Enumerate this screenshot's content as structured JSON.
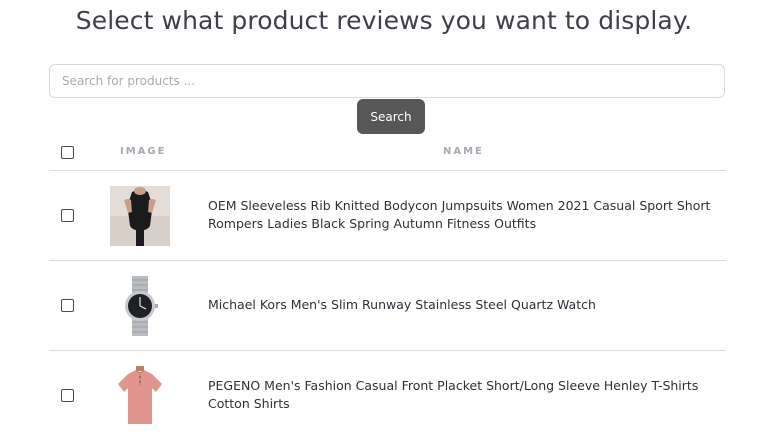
{
  "header": {
    "title": "Select what product reviews you want to display."
  },
  "search": {
    "placeholder": "Search for products ...",
    "value": "",
    "button_label": "Search"
  },
  "table": {
    "columns": [
      "IMAGE",
      "NAME"
    ],
    "rows": [
      {
        "image_icon": "bodysuit-product-photo",
        "name": "OEM Sleeveless Rib Knitted Bodycon Jumpsuits Women 2021 Casual Sport Short Rompers Ladies Black Spring Autumn Fitness Outfits",
        "checked": false
      },
      {
        "image_icon": "watch-product-photo",
        "name": "Michael Kors Men's Slim Runway Stainless Steel Quartz Watch",
        "checked": false
      },
      {
        "image_icon": "tshirt-product-photo",
        "name": "PEGENO Men's Fashion Casual Front Placket Short/Long Sleeve Henley T-Shirts Cotton Shirts",
        "checked": false
      }
    ]
  },
  "colors": {
    "button_bg": "#575757",
    "border": "#dcdcdf",
    "header_text": "#a8a8b3"
  }
}
